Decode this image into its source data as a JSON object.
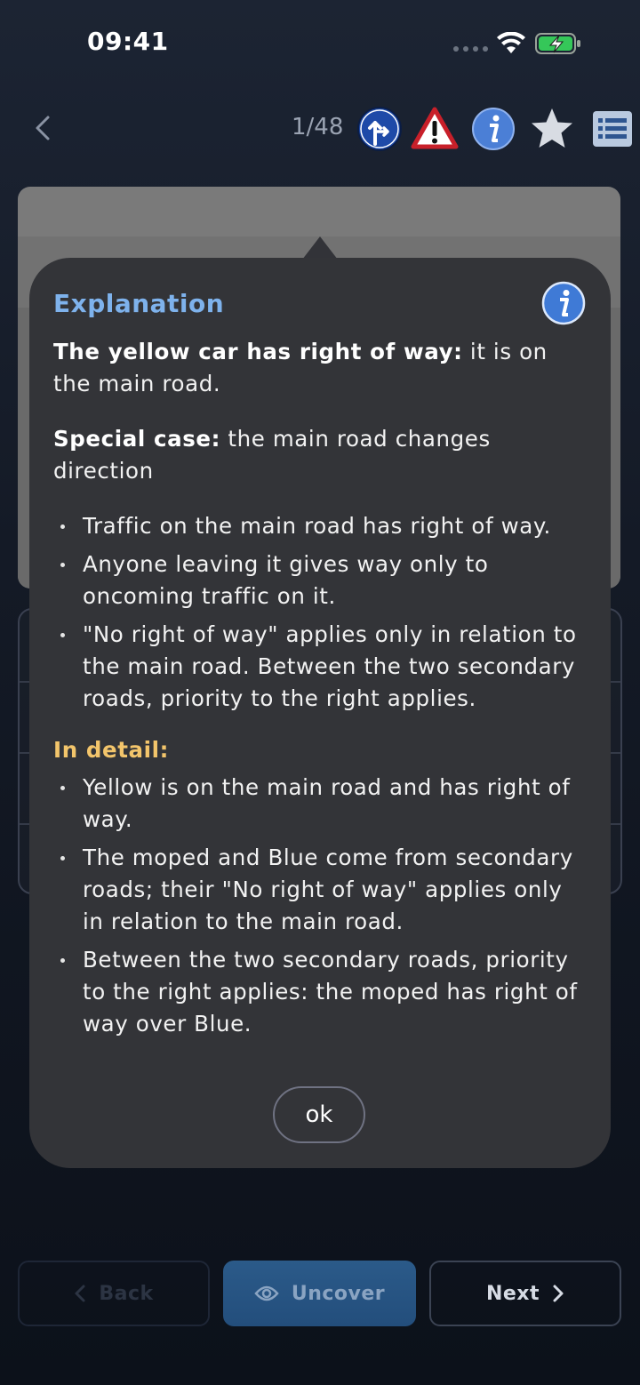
{
  "status_bar": {
    "time": "09:41"
  },
  "nav": {
    "counter": "1/48"
  },
  "modal": {
    "title": "Explanation",
    "p1_bold": "The yellow car has right of way:",
    "p1_rest": " it is on the main road.",
    "p2_bold": "Special case:",
    "p2_rest": " the main road changes direction",
    "bullets": [
      "Traffic on the main road has right of way.",
      "Anyone leaving it gives way only to oncoming traffic on it.",
      "\"No right of way\" applies only in relation to the main road. Between the two secondary roads, priority to the right applies."
    ],
    "detail_title": "In detail:",
    "detail_bullets": [
      "Yellow is on the main road and has right of way.",
      "The moped and Blue come from secondary roads; their \"No right of way\" applies only in relation to the main road.",
      "Between the two secondary roads, priority to the right applies: the moped has right of way over Blue."
    ],
    "ok_label": "ok"
  },
  "bottom": {
    "back_label": "Back",
    "uncover_label": "Uncover",
    "next_label": "Next"
  },
  "colors": {
    "title_blue": "#7eb2ec",
    "detail_yellow": "#f3c56b",
    "modal_bg": "#333438"
  }
}
